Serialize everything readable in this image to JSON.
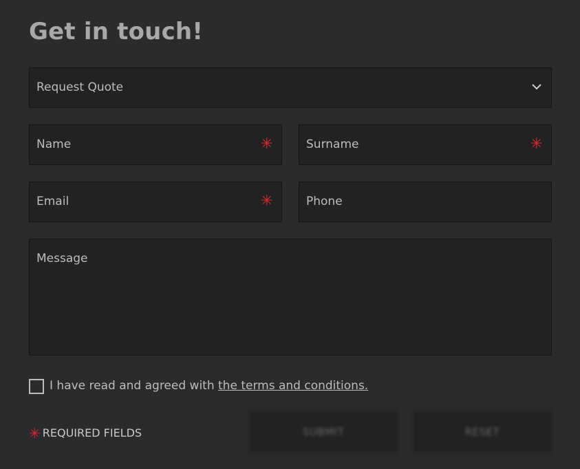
{
  "form": {
    "title": "Get in touch!",
    "request_type": "Request Quote",
    "name_placeholder": "Name",
    "surname_placeholder": "Surname",
    "email_placeholder": "Email",
    "phone_placeholder": "Phone",
    "message_placeholder": "Message",
    "required_marker": "✳",
    "terms_prefix": "I have read and agreed with ",
    "terms_link": "the terms and conditions.",
    "required_note": "REQUIRED FIELDS",
    "submit_label": "SUBMIT",
    "reset_label": "RESET",
    "accent_color": "#d8262e"
  }
}
